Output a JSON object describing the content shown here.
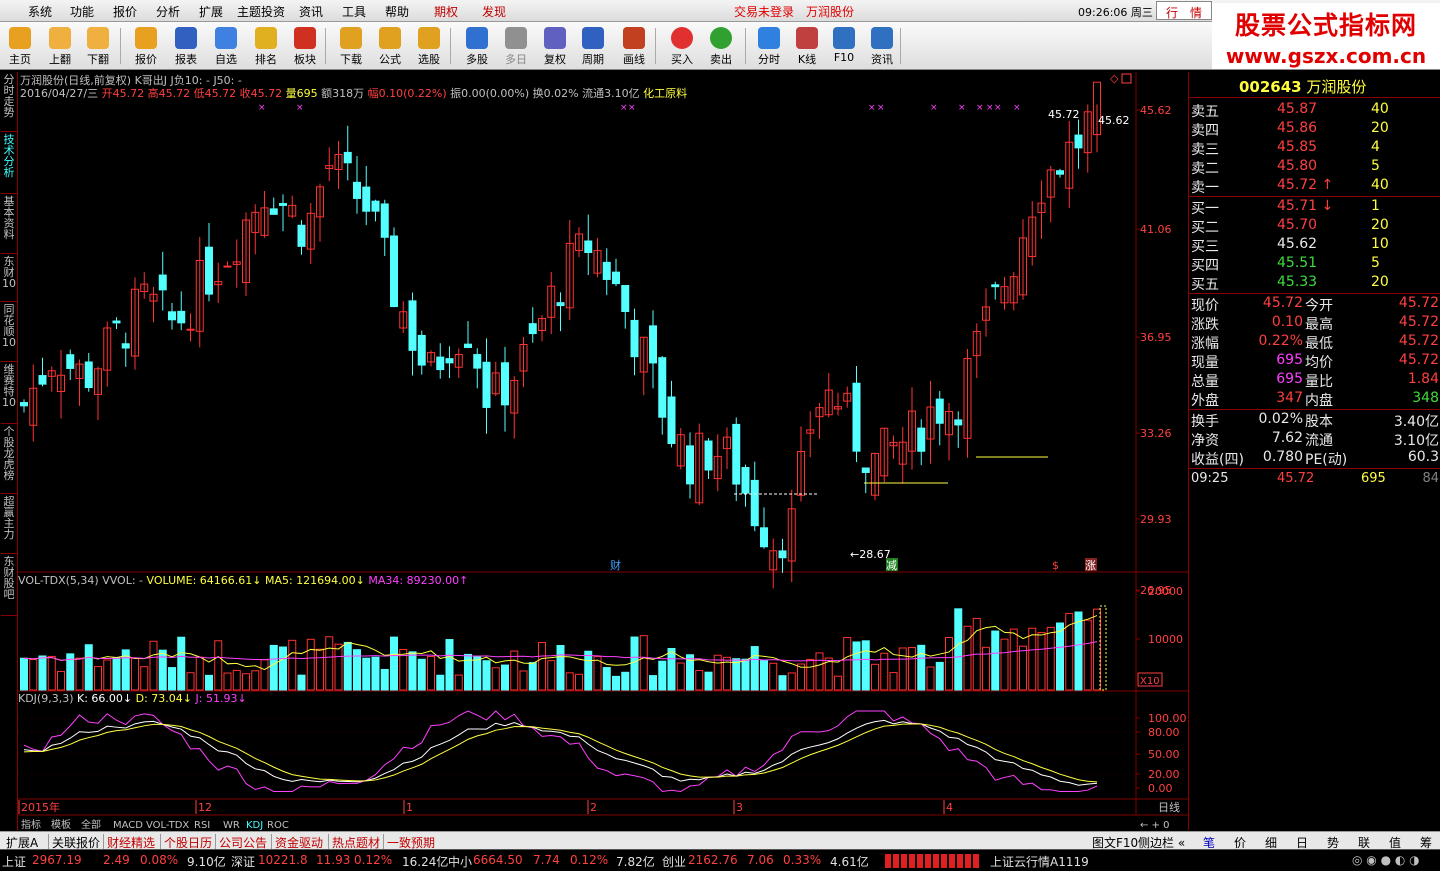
{
  "menu": {
    "items": [
      "系统",
      "功能",
      "报价",
      "分析",
      "扩展",
      "主题投资",
      "资讯",
      "工具",
      "帮助"
    ],
    "qiquan": "期权",
    "faxian": "发现",
    "login": "交易未登录",
    "stock": "万润股份",
    "time": "09:26:06 周三",
    "hangqing": "行　情"
  },
  "brand": {
    "line1": "股票公式指标网",
    "line2": "www.gszx.com.cn"
  },
  "toolbar": {
    "items": [
      "主页",
      "上翻",
      "下翻",
      "报价",
      "报表",
      "自选",
      "排名",
      "板块",
      "下载",
      "公式",
      "选股",
      "多股",
      "多日",
      "复权",
      "周期",
      "画线",
      "买入",
      "卖出",
      "分时",
      "K线",
      "F10",
      "资讯"
    ]
  },
  "leftnav": [
    "分时走势",
    "技术分析",
    "基本资料",
    "东财10",
    "同花顺10",
    "维赛特10",
    "个股龙虎榜",
    "超赢主力",
    "东财股吧"
  ],
  "chart": {
    "header1": "万润股份(日线,前复权) K哥出J  J负10: -  J50: -",
    "header2_date": "2016/04/27/三",
    "header2_open": "开45.72",
    "header2_high": "高45.72",
    "header2_low": "低45.72",
    "header2_close": "收45.72",
    "header2_vol": "量695",
    "header2_amt": "额318万",
    "header2_fu": "幅0.10(0.22%)",
    "header2_zhen": "振0.00(0.00%)",
    "header2_huan": "换0.02%",
    "header2_liutong": "流通3.10亿",
    "header2_industry": "化工原料",
    "price_ticks": [
      "45.62",
      "41.06",
      "36.95",
      "33.26",
      "29.93",
      "26.95"
    ],
    "hi_label": "45.72",
    "hi_label2": "45.62",
    "lo_label": "28.67",
    "event_cai": "财",
    "event_jian": "减",
    "event_s": "$",
    "event_zhang": "涨",
    "vol_header_name": "VOL-TDX(5,34)",
    "vol_header_vvol": "VVOL: -",
    "vol_header_volume": "VOLUME: 64166.61",
    "vol_header_ma5": "MA5: 121694.00",
    "vol_header_ma34": "MA34: 89230.00",
    "vol_ticks": [
      "20000",
      "10000"
    ],
    "vol_unit": "X10",
    "kdj_header_name": "KDJ(9,3,3)",
    "kdj_k": "K: 66.00",
    "kdj_d": "D: 73.04",
    "kdj_j": "J: 51.93",
    "kdj_ticks": [
      "100.00",
      "80.00",
      "50.00",
      "20.00",
      "0.00"
    ],
    "time_labels": [
      "2015年",
      "12",
      "1",
      "2",
      "3",
      "4"
    ],
    "period": "日线",
    "tabs": [
      "指标",
      "模板",
      "全部",
      "MACD",
      "VOL-TDX",
      "RSI",
      "WR",
      "KDJ",
      "ROC"
    ],
    "tabs_active": "KDJ"
  },
  "right": {
    "code": "002643",
    "name": "万润股份",
    "sell": [
      [
        "卖五",
        "45.87",
        "40"
      ],
      [
        "卖四",
        "45.86",
        "20"
      ],
      [
        "卖三",
        "45.85",
        "4"
      ],
      [
        "卖二",
        "45.80",
        "5"
      ],
      [
        "卖一",
        "45.72",
        "40"
      ]
    ],
    "buy": [
      [
        "买一",
        "45.71",
        "1"
      ],
      [
        "买二",
        "45.70",
        "20"
      ],
      [
        "买三",
        "45.62",
        "10"
      ],
      [
        "买四",
        "45.51",
        "5"
      ],
      [
        "买五",
        "45.33",
        "20"
      ]
    ],
    "stats": [
      [
        "现价",
        "45.72",
        "今开",
        "45.72"
      ],
      [
        "涨跌",
        "0.10",
        "最高",
        "45.72"
      ],
      [
        "涨幅",
        "0.22%",
        "最低",
        "45.72"
      ],
      [
        "现量",
        "695",
        "均价",
        "45.72"
      ],
      [
        "总量",
        "695",
        "量比",
        "1.84"
      ],
      [
        "外盘",
        "347",
        "内盘",
        "348"
      ]
    ],
    "stats2": [
      [
        "换手",
        "0.02%",
        "股本",
        "3.40亿"
      ],
      [
        "净资",
        "7.62",
        "流通",
        "3.10亿"
      ],
      [
        "收益(四)",
        "0.780",
        "PE(动)",
        "60.3"
      ]
    ],
    "tick": {
      "time": "09:25",
      "price": "45.72",
      "vol": "695",
      "num": "84"
    },
    "tabs": [
      "笔",
      "价",
      "细",
      "日",
      "势",
      "联",
      "值",
      "筹"
    ]
  },
  "bottom": {
    "items": [
      "扩展A",
      "关联报价",
      "财经精选",
      "个股日历",
      "公司公告",
      "资金驱动",
      "热点题材",
      "一致预期"
    ],
    "right1": "图文F10",
    "right2": "侧边栏"
  },
  "status": {
    "sh_label": "上证",
    "sh_val": "2967.19",
    "sh_chg": "2.49",
    "sh_pct": "0.08%",
    "sh_amt": "9.10亿",
    "sz_label": "深证",
    "sz_val": "10221.8",
    "sz_chg": "11.93",
    "sz_pct": "0.12%",
    "sz_amt": "16.24亿",
    "zx_label": "中小",
    "zx_val": "6664.50",
    "zx_chg": "7.74",
    "zx_pct": "0.12%",
    "zx_amt": "7.82亿",
    "cy_label": "创业",
    "cy_val": "2162.76",
    "cy_chg": "7.06",
    "cy_pct": "0.33%",
    "cy_amt": "4.61亿",
    "server": "上证云行情A1119"
  },
  "colors": {
    "up": "#ff3232",
    "down": "#54ffff",
    "bg": "#000000",
    "grid": "#800000",
    "ma5": "#ffffff",
    "ma34": "#ff40ff"
  }
}
